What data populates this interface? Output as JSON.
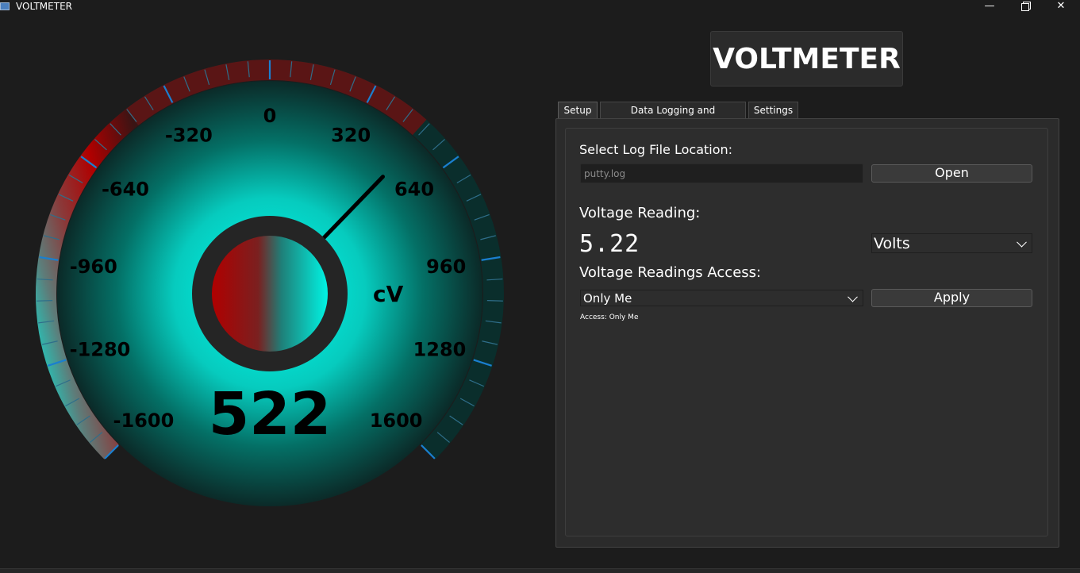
{
  "window": {
    "title": "VOLTMETER",
    "controls": [
      "—",
      "□",
      "✕"
    ]
  },
  "gauge": {
    "min": -1600,
    "max": 1600,
    "ticks": [
      "-1600",
      "-1280",
      "-960",
      "-640",
      "-320",
      "0",
      "320",
      "640",
      "960",
      "1280",
      "1600"
    ],
    "value": 522,
    "reading_display": "522",
    "unit": "cV",
    "colors": {
      "negative": "#b30000",
      "positive": "#00e6d6",
      "glow": "#00e6d6",
      "accent": "#1a7fcf"
    }
  },
  "brand": {
    "title": "VOLTMETER"
  },
  "tabs": [
    {
      "label": "Setup",
      "active": true
    },
    {
      "label": "Data Logging and Visualization",
      "active": false
    },
    {
      "label": "Settings",
      "active": false
    }
  ],
  "setup": {
    "log_label": "Select Log File Location:",
    "log_file": "putty.log",
    "open_button": "Open",
    "voltage_label": "Voltage Reading:",
    "voltage_value": "5.22",
    "units_selected": "Volts",
    "access_label": "Voltage Readings Access:",
    "access_selected": "Only Me",
    "apply_button": "Apply",
    "access_status": "Access: Only Me"
  }
}
